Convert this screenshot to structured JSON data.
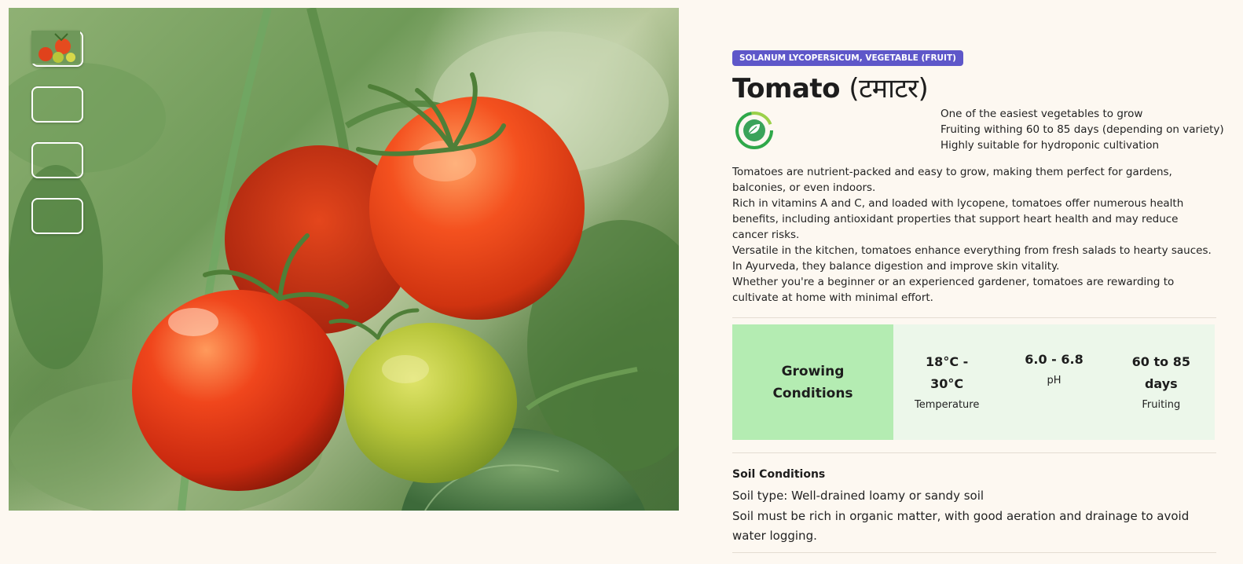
{
  "product": {
    "badge": "SOLANUM LYCOPERSICUM, VEGETABLE (FRUIT)",
    "title_en": "Tomato",
    "title_local": "(टमाटर)",
    "highlights": [
      "One of the easiest vegetables to grow",
      "Fruiting withing 60 to 85 days (depending on variety)",
      "Highly suitable for hydroponic cultivation"
    ],
    "description": [
      "Tomatoes are nutrient-packed and easy to grow, making them perfect for gardens, balconies, or even indoors.",
      "Rich in vitamins A and C, and loaded with lycopene, tomatoes offer numerous health benefits, including antioxidant properties that support heart health and may reduce cancer risks.",
      "Versatile in the kitchen, tomatoes enhance everything from fresh salads to hearty sauces.",
      "In Ayurveda, they balance digestion and improve skin vitality.",
      "Whether you're a beginner or an experienced gardener, tomatoes are rewarding to cultivate at home with minimal effort."
    ]
  },
  "growing_conditions": {
    "heading_line1": "Growing",
    "heading_line2": "Conditions",
    "stats": [
      {
        "value_line1": "18°C -",
        "value_line2": "30°C",
        "label": "Temperature"
      },
      {
        "value_line1": "6.0 - 6.8",
        "value_line2": "",
        "label": "pH"
      },
      {
        "value_line1": "60 to 85",
        "value_line2": "days",
        "label": "Fruiting"
      }
    ]
  },
  "soil": {
    "title": "Soil Conditions",
    "lines": [
      "Soil type: Well-drained loamy or sandy soil",
      "Soil must be rich in organic matter, with good aeration and drainage to avoid water logging."
    ]
  },
  "gallery": {
    "thumbnail_count": 4,
    "main_image": "tomato-cluster-photo"
  },
  "icons": {
    "eco": "eco-leaf-cycle-icon"
  },
  "colors": {
    "badge": "#5e57c9",
    "growing_heading_bg": "#b4ecb2",
    "growing_stats_bg": "#ecf7ea",
    "page_bg": "#fdf8f1",
    "tomato_red": "#e8401c",
    "unripe_green": "#b5c633"
  }
}
